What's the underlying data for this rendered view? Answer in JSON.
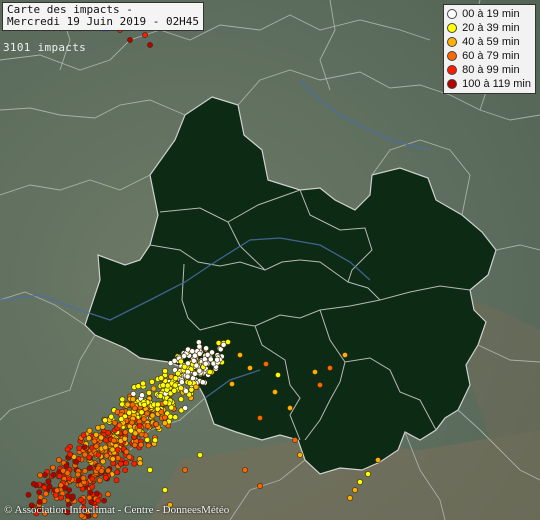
{
  "title": {
    "line1": "Carte des impacts -",
    "line2": "Mercredi 19 Juin 2019 - 02H45"
  },
  "impact_count": "3101 impacts",
  "legend": [
    {
      "label": "00 à 19 min",
      "color": "#ffffff"
    },
    {
      "label": "20 à 39 min",
      "color": "#ffff00"
    },
    {
      "label": "40 à 59 min",
      "color": "#ffb000"
    },
    {
      "label": "60 à 79 min",
      "color": "#ff6600"
    },
    {
      "label": "80 à 99 min",
      "color": "#ff1a00"
    },
    {
      "label": "100 à 119 min",
      "color": "#b30000"
    }
  ],
  "credit": "© Association Infoclimat - Centre - DonneesMétéo",
  "colors": {
    "land": "#5f6f5f",
    "region": "#0d2a14",
    "borders": "#c8c8c8",
    "river": "#4a6ea8"
  }
}
